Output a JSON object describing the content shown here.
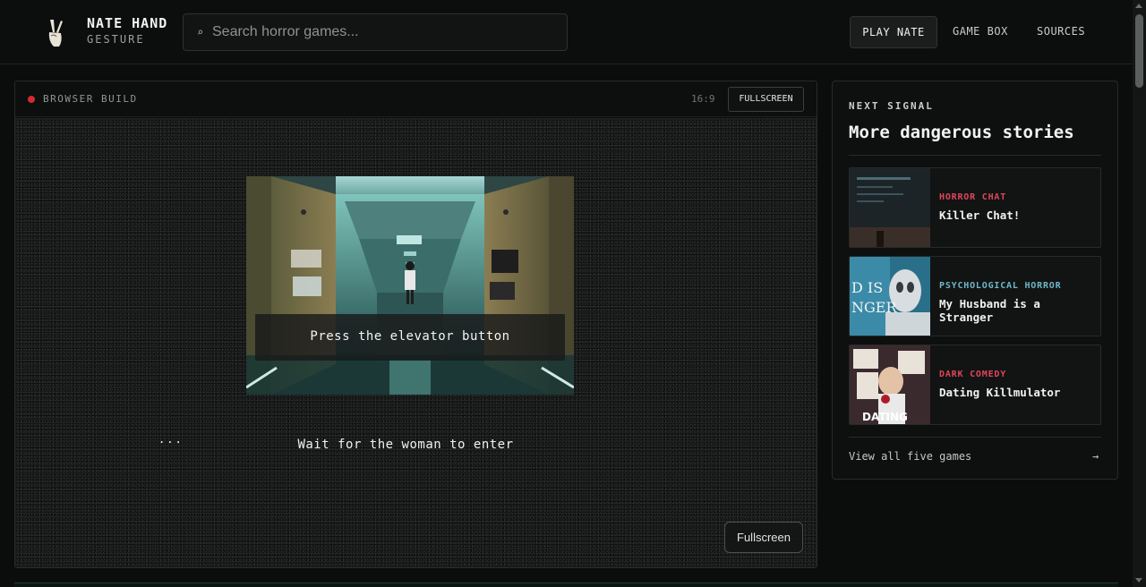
{
  "brand": {
    "title": "NATE HAND",
    "subtitle": "GESTURE",
    "logo_icon": "peace-hand-icon"
  },
  "search": {
    "icon": "search-icon",
    "value": "",
    "placeholder": "Search horror games..."
  },
  "nav": {
    "items": [
      {
        "label": "PLAY NATE",
        "active": true
      },
      {
        "label": "GAME BOX",
        "active": false
      },
      {
        "label": "SOURCES",
        "active": false
      }
    ]
  },
  "game": {
    "status_label": "BROWSER BUILD",
    "status_color": "#d42a33",
    "aspect_ratio": "16:9",
    "fullscreen_top_label": "FULLSCREEN",
    "fullscreen_bottom_label": "Fullscreen",
    "prompt": "Press the elevator button",
    "ellipsis": "...",
    "subtitle": "Wait for the woman to enter"
  },
  "sidebar": {
    "eyebrow": "NEXT SIGNAL",
    "title": "More dangerous stories",
    "cards": [
      {
        "tag": "HORROR CHAT",
        "tag_color": "#e0445c",
        "name": "Killer Chat!"
      },
      {
        "tag": "PSYCHOLOGICAL HORROR",
        "tag_color": "#6fb6c8",
        "name": "My Husband is a Stranger"
      },
      {
        "tag": "DARK COMEDY",
        "tag_color": "#e0445c",
        "name": "Dating Killmulator"
      }
    ],
    "view_all_label": "View all five games",
    "view_all_arrow": "→"
  }
}
